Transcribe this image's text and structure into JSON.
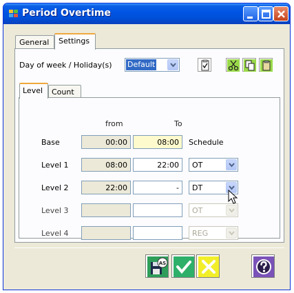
{
  "window": {
    "title": "Period Overtime",
    "accent": "#0054e3"
  },
  "tabs": [
    {
      "label": "General",
      "active": false
    },
    {
      "label": "Settings",
      "active": true
    }
  ],
  "settings": {
    "dow_label": "Day of week / Holiday(s)",
    "dow_value": "Default"
  },
  "toolbar_icons": [
    "checklist-icon",
    "cut-icon",
    "copy-icon",
    "paste-icon"
  ],
  "inner_tabs": [
    {
      "label": "Level",
      "active": true
    },
    {
      "label": "Count",
      "active": false
    }
  ],
  "table": {
    "col_from": "from",
    "col_to": "To",
    "schedule_label": "Schedule",
    "rows": [
      {
        "label": "Base",
        "from": "00:00",
        "to": "08:00",
        "schedule": "",
        "enabled": true
      },
      {
        "label": "Level 1",
        "from": "08:00",
        "to": "22:00",
        "schedule": "OT",
        "enabled": true
      },
      {
        "label": "Level 2",
        "from": "22:00",
        "to": "-",
        "schedule": "DT",
        "enabled": true
      },
      {
        "label": "Level 3",
        "from": "",
        "to": "",
        "schedule": "OT",
        "enabled": false
      },
      {
        "label": "Level 4",
        "from": "",
        "to": "",
        "schedule": "REG",
        "enabled": false
      }
    ]
  },
  "bottom_buttons": [
    {
      "name": "save-as-button",
      "icon": "save-as-icon",
      "badge": "AS"
    },
    {
      "name": "ok-button",
      "icon": "checkmark-icon"
    },
    {
      "name": "cancel-button",
      "icon": "cross-icon"
    },
    {
      "name": "help-button",
      "icon": "question-icon"
    }
  ]
}
